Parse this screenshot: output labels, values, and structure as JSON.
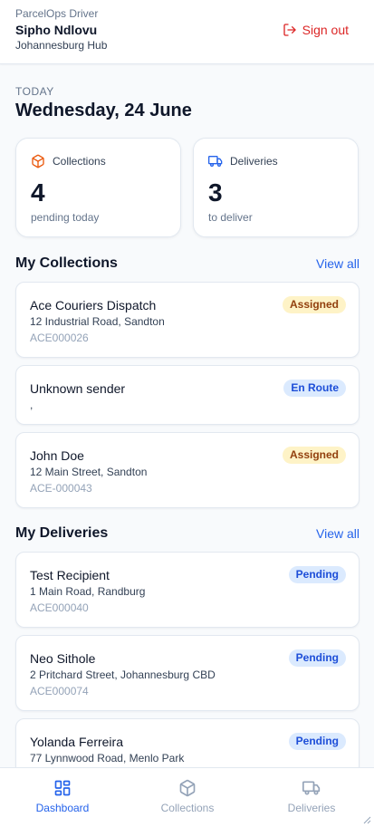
{
  "header": {
    "app_name": "ParcelOps Driver",
    "driver_name": "Sipho Ndlovu",
    "hub": "Johannesburg Hub",
    "sign_out": "Sign out"
  },
  "today": {
    "label": "TODAY",
    "date": "Wednesday, 24 June"
  },
  "stats": {
    "collections": {
      "label": "Collections",
      "value": "4",
      "sub": "pending today",
      "icon": "box-icon"
    },
    "deliveries": {
      "label": "Deliveries",
      "value": "3",
      "sub": "to deliver",
      "icon": "truck-icon"
    }
  },
  "my_collections": {
    "title": "My Collections",
    "view_all": "View all",
    "items": [
      {
        "name": "Ace Couriers Dispatch",
        "address": "12 Industrial Road, Sandton",
        "ref": "ACE000026",
        "status": "Assigned"
      },
      {
        "name": "Unknown sender",
        "address": ",",
        "ref": "",
        "status": "En Route"
      },
      {
        "name": "John Doe",
        "address": "12 Main Street, Sandton",
        "ref": "ACE-000043",
        "status": "Assigned"
      }
    ]
  },
  "my_deliveries": {
    "title": "My Deliveries",
    "view_all": "View all",
    "items": [
      {
        "name": "Test Recipient",
        "address": "1 Main Road, Randburg",
        "ref": "ACE000040",
        "status": "Pending"
      },
      {
        "name": "Neo Sithole",
        "address": "2 Pritchard Street, Johannesburg CBD",
        "ref": "ACE000074",
        "status": "Pending"
      },
      {
        "name": "Yolanda Ferreira",
        "address": "77 Lynnwood Road, Menlo Park",
        "ref": "",
        "status": "Pending"
      }
    ]
  },
  "tabs": [
    {
      "label": "Dashboard",
      "icon": "grid-icon",
      "active": true
    },
    {
      "label": "Collections",
      "icon": "box-icon",
      "active": false
    },
    {
      "label": "Deliveries",
      "icon": "truck-icon",
      "active": false
    }
  ],
  "colors": {
    "accent": "#2563eb",
    "danger": "#dc2626",
    "assigned_bg": "#fef3c7",
    "assigned_fg": "#92400e",
    "pending_bg": "#dbeafe",
    "pending_fg": "#1d4ed8",
    "box_icon": "#ea580c"
  }
}
